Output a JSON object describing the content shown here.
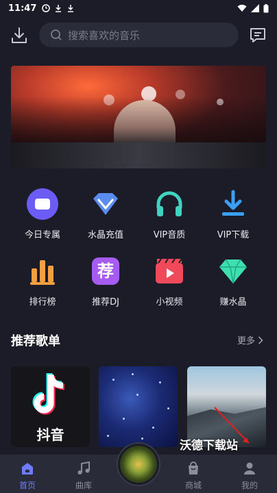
{
  "status_bar": {
    "time": "11:47"
  },
  "search": {
    "placeholder": "搜索喜欢的音乐"
  },
  "quick_grid": [
    {
      "label": "今日专属",
      "icon": "today-icon",
      "color": "#6b5cf6"
    },
    {
      "label": "水晶充值",
      "icon": "crystal-icon",
      "color": "#5b8df0"
    },
    {
      "label": "VIP音质",
      "icon": "headphones-icon",
      "color": "#3fd3c0"
    },
    {
      "label": "VIP下载",
      "icon": "download-icon",
      "color": "#3aa0f5"
    },
    {
      "label": "排行榜",
      "icon": "ranking-icon",
      "color": "#f5a040"
    },
    {
      "label": "推荐DJ",
      "icon": "recommend-icon",
      "color": "#a65cf0"
    },
    {
      "label": "小视频",
      "icon": "video-icon",
      "color": "#f04a5a"
    },
    {
      "label": "赚水晶",
      "icon": "gem-icon",
      "color": "#3fe0b0"
    }
  ],
  "recommend_icon_glyph": "荐",
  "playlists_section": {
    "title": "推荐歌单",
    "more": "更多"
  },
  "playlists": [
    {
      "name": "抖音"
    }
  ],
  "watermark": "沃德下载站",
  "tabs": [
    {
      "label": "首页",
      "icon": "home-icon",
      "active": true
    },
    {
      "label": "曲库",
      "icon": "music-note-icon",
      "active": false
    },
    {
      "label": "商城",
      "icon": "shop-icon",
      "active": false
    },
    {
      "label": "我的",
      "icon": "profile-icon",
      "active": false
    }
  ]
}
